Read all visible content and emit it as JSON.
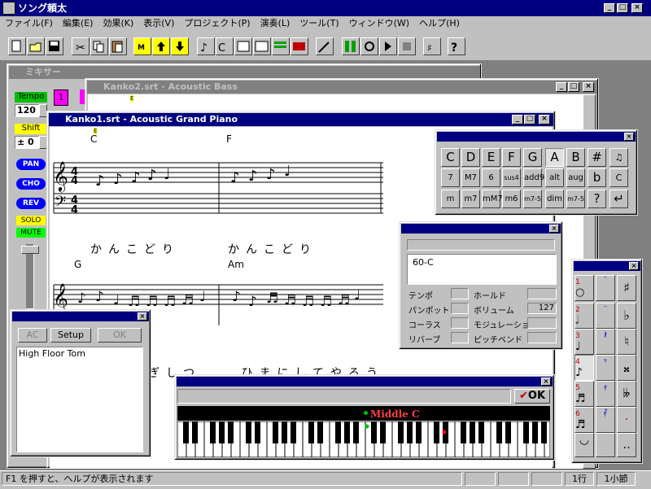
{
  "app": {
    "title": "ソング頼太"
  },
  "menu": [
    "ファイル(F)",
    "編集(E)",
    "効果(K)",
    "表示(V)",
    "プロジェクト(P)",
    "演奏(L)",
    "ツール(T)",
    "ウィンドウ(W)",
    "ヘルプ(H)"
  ],
  "mixer": {
    "title": "ミキサー",
    "tempo_label": "Tempo",
    "tempo_value": "120",
    "shift_label": "Shift",
    "shift_value": "± 0",
    "buttons": [
      "PAN",
      "CHO",
      "REV",
      "SOLO",
      "MUTE"
    ],
    "channel_1": "1",
    "colors": {
      "tempo": "#00c000",
      "shift": "#ffff00",
      "blue": "#0000ff",
      "solo": "#ffff00",
      "mute": "#00ff00",
      "magenta": "#ff00ff"
    }
  },
  "win_bass": {
    "title": "Kanko2.srt - Acoustic Bass",
    "mark": "E"
  },
  "win_piano": {
    "title": "Kanko1.srt - Acoustic Grand Piano",
    "chords_row1": [
      "C",
      "F"
    ],
    "lyrics_row1": [
      "かんこどり",
      "かんこどり"
    ],
    "chords_row2": [
      "G",
      "Am"
    ],
    "lyrics_row3": "ぎしつ   ひまにしてやろう",
    "mark": "E"
  },
  "chord_palette": {
    "row1": [
      "C",
      "D",
      "E",
      "F",
      "G",
      "A",
      "B",
      "#"
    ],
    "row2": [
      "7",
      "M7",
      "6",
      "sus4",
      "add9",
      "alt",
      "aug",
      "b"
    ],
    "row3": [
      "m",
      "m7",
      "mM7",
      "m6",
      "m7-5",
      "dim",
      "m7-5",
      "?"
    ],
    "selected": "A"
  },
  "note_props": {
    "value": "60-C",
    "labels_left": [
      "テンポ",
      "パンポット",
      "コーラス",
      "リバーブ"
    ],
    "labels_right": [
      "ホールド",
      "ボリューム",
      "モジュレーション",
      "ピッチベンド"
    ],
    "volume_value": "127"
  },
  "drum_panel": {
    "buttons": [
      "AC",
      "Setup",
      "OK"
    ],
    "selected_item": "High Floor Tom"
  },
  "keyboard": {
    "ok_label": "OK",
    "middle_c_label": "Middle C"
  },
  "note_palette": {
    "numbers": [
      "1",
      "2",
      "3",
      "4",
      "5",
      "6"
    ]
  },
  "status": {
    "help_text": "F1 を押すと、ヘルプが表示されます",
    "row": "1行",
    "measure": "1小節"
  }
}
